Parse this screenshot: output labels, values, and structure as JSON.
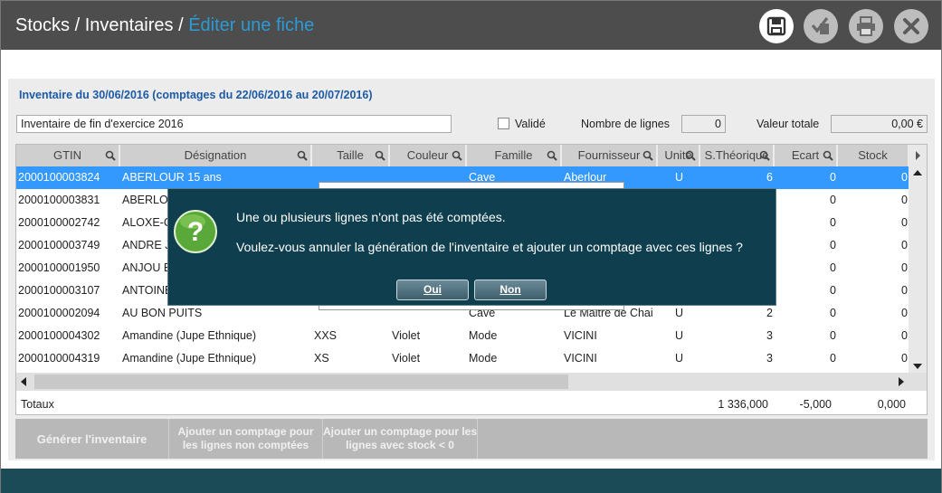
{
  "header": {
    "crumb1": "Stocks",
    "sep1": " / ",
    "crumb2": "Inventaires",
    "sep2": " / ",
    "current": "Éditer une fiche",
    "icons": [
      "save-icon",
      "validate-icon",
      "print-icon",
      "close-icon"
    ]
  },
  "form": {
    "inventory_title": "Inventaire du 30/06/2016 (comptages du 22/06/2016 au 20/07/2016)",
    "description_value": "Inventaire de fin d'exercice 2016",
    "validated_label": "Validé",
    "validated_checked": false,
    "line_count_label": "Nombre de lignes",
    "line_count_value": "0",
    "total_value_label": "Valeur totale",
    "total_value": "0,00 €"
  },
  "grid": {
    "columns": [
      "GTIN",
      "Désignation",
      "Taille",
      "Couleur",
      "Famille",
      "Fournisseur",
      "Unité",
      "S.Théorique",
      "Ecart",
      "Stock"
    ],
    "rows": [
      {
        "gtin": "2000100003824",
        "des": "ABERLOUR 15 ans",
        "taille": "",
        "couleur": "",
        "famille": "Cave",
        "fourn": "Aberlour",
        "unite": "U",
        "theo": "6",
        "ecart": "0",
        "stock": "0"
      },
      {
        "gtin": "2000100003831",
        "des": "ABERLO",
        "taille": "",
        "couleur": "",
        "famille": "",
        "fourn": "",
        "unite": "",
        "theo": "",
        "ecart": "0",
        "stock": "0"
      },
      {
        "gtin": "2000100002742",
        "des": "ALOXE-C",
        "taille": "",
        "couleur": "",
        "famille": "",
        "fourn": "",
        "unite": "",
        "theo": "",
        "ecart": "0",
        "stock": "0"
      },
      {
        "gtin": "2000100003749",
        "des": "ANDRE J",
        "taille": "",
        "couleur": "",
        "famille": "",
        "fourn": "",
        "unite": "",
        "theo": "",
        "ecart": "0",
        "stock": "0"
      },
      {
        "gtin": "2000100001950",
        "des": "ANJOU B",
        "taille": "",
        "couleur": "",
        "famille": "",
        "fourn": "",
        "unite": "",
        "theo": "",
        "ecart": "0",
        "stock": "0"
      },
      {
        "gtin": "2000100003107",
        "des": "ANTOINE",
        "taille": "",
        "couleur": "",
        "famille": "",
        "fourn": "",
        "unite": "",
        "theo": "",
        "ecart": "0",
        "stock": "0"
      },
      {
        "gtin": "2000100002094",
        "des": "AU BON PUITS",
        "taille": "",
        "couleur": "",
        "famille": "Cave",
        "fourn": "Le Maitre de Chai",
        "unite": "U",
        "theo": "2",
        "ecart": "0",
        "stock": "0"
      },
      {
        "gtin": "2000100004302",
        "des": "Amandine (Jupe Ethnique)",
        "taille": "XXS",
        "couleur": "Violet",
        "famille": "Mode",
        "fourn": "VICINI",
        "unite": "U",
        "theo": "3",
        "ecart": "0",
        "stock": "0"
      },
      {
        "gtin": "2000100004319",
        "des": "Amandine (Jupe Ethnique)",
        "taille": "XS",
        "couleur": "Violet",
        "famille": "Mode",
        "fourn": "VICINI",
        "unite": "U",
        "theo": "3",
        "ecart": "0",
        "stock": "0"
      }
    ],
    "totals_label": "Totaux",
    "totals_theo": "1 336,000",
    "totals_ecart": "-5,000",
    "totals_stock": "0,000"
  },
  "actions": {
    "generate": "Générer l'inventaire",
    "add_uncounted": "Ajouter un comptage pour les lignes non comptées",
    "add_stock_lt0": "Ajouter un comptage pour les lignes avec stock < 0"
  },
  "dialog": {
    "icon": "question-icon",
    "line1": "Une ou plusieurs lignes n'ont pas été comptées.",
    "line2": "Voulez-vous annuler la génération de l'inventaire et ajouter un comptage avec ces lignes ?",
    "yes": "Oui",
    "no": "Non"
  }
}
